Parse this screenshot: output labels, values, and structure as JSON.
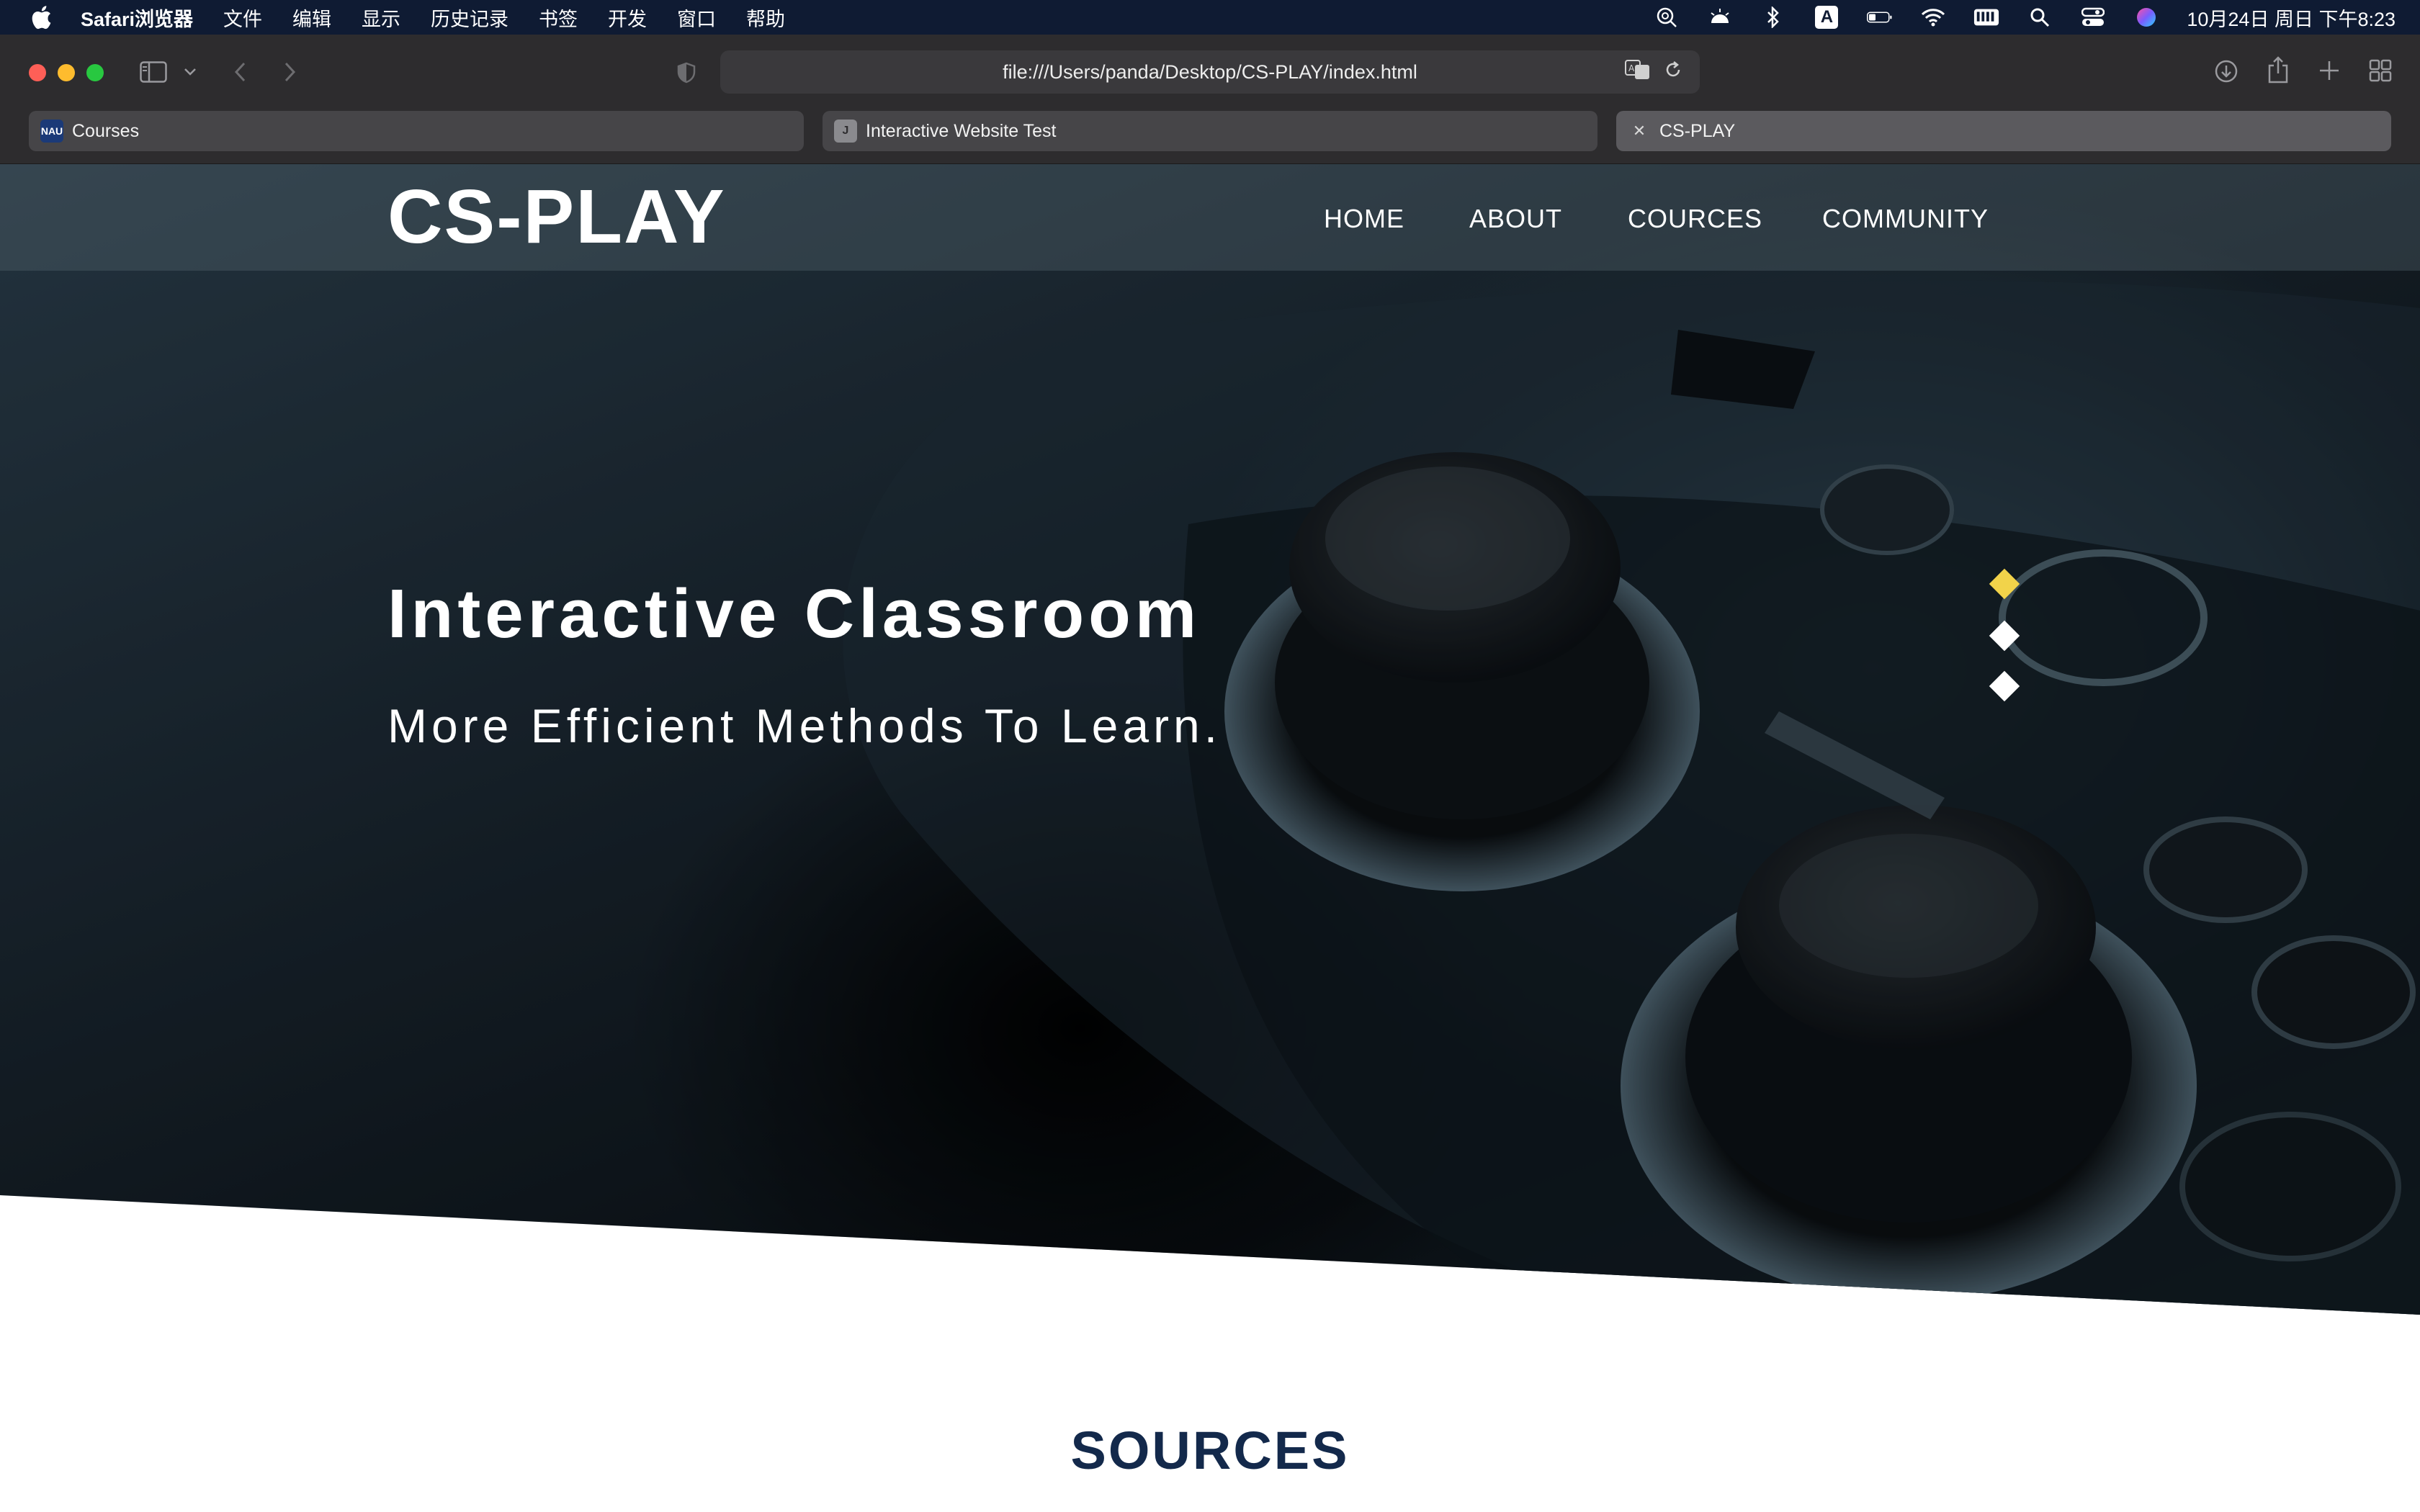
{
  "menubar": {
    "app_name": "Safari浏览器",
    "items": [
      "文件",
      "编辑",
      "显示",
      "历史记录",
      "书签",
      "开发",
      "窗口",
      "帮助"
    ],
    "clock": "10月24日 周日 下午8:23",
    "status_icons": [
      "lookup-icon",
      "brightness-icon",
      "bluetooth-icon",
      "input-source-icon",
      "battery-icon",
      "wifi-icon",
      "keyboard-icon",
      "spotlight-icon",
      "control-center-icon",
      "siri-icon"
    ],
    "input_source_label": "A"
  },
  "browser": {
    "url": "file:///Users/panda/Desktop/CS-PLAY/index.html",
    "tabs": [
      {
        "title": "Courses",
        "favicon": "NAU",
        "favicon_bg": "#1b3a78",
        "active": false
      },
      {
        "title": "Interactive Website Test",
        "favicon": "J",
        "favicon_bg": "#8a8a8e",
        "active": false
      },
      {
        "title": "CS-PLAY",
        "favicon": "✕",
        "favicon_bg": "transparent",
        "active": true
      }
    ]
  },
  "site": {
    "logo": "CS-PLAY",
    "nav": [
      "HOME",
      "ABOUT",
      "COURCES",
      "COMMUNITY"
    ],
    "hero": {
      "title": "Interactive Classroom",
      "subtitle": "More Efficient Methods To Learn."
    },
    "slider": {
      "count": 3,
      "active_index": 0,
      "active_color": "#f2d34a"
    },
    "section_title": "SOURCES"
  },
  "colors": {
    "menubar_bg": "#0f1b33",
    "toolbar_bg": "#2d2c2e",
    "section_title": "#13294b"
  }
}
